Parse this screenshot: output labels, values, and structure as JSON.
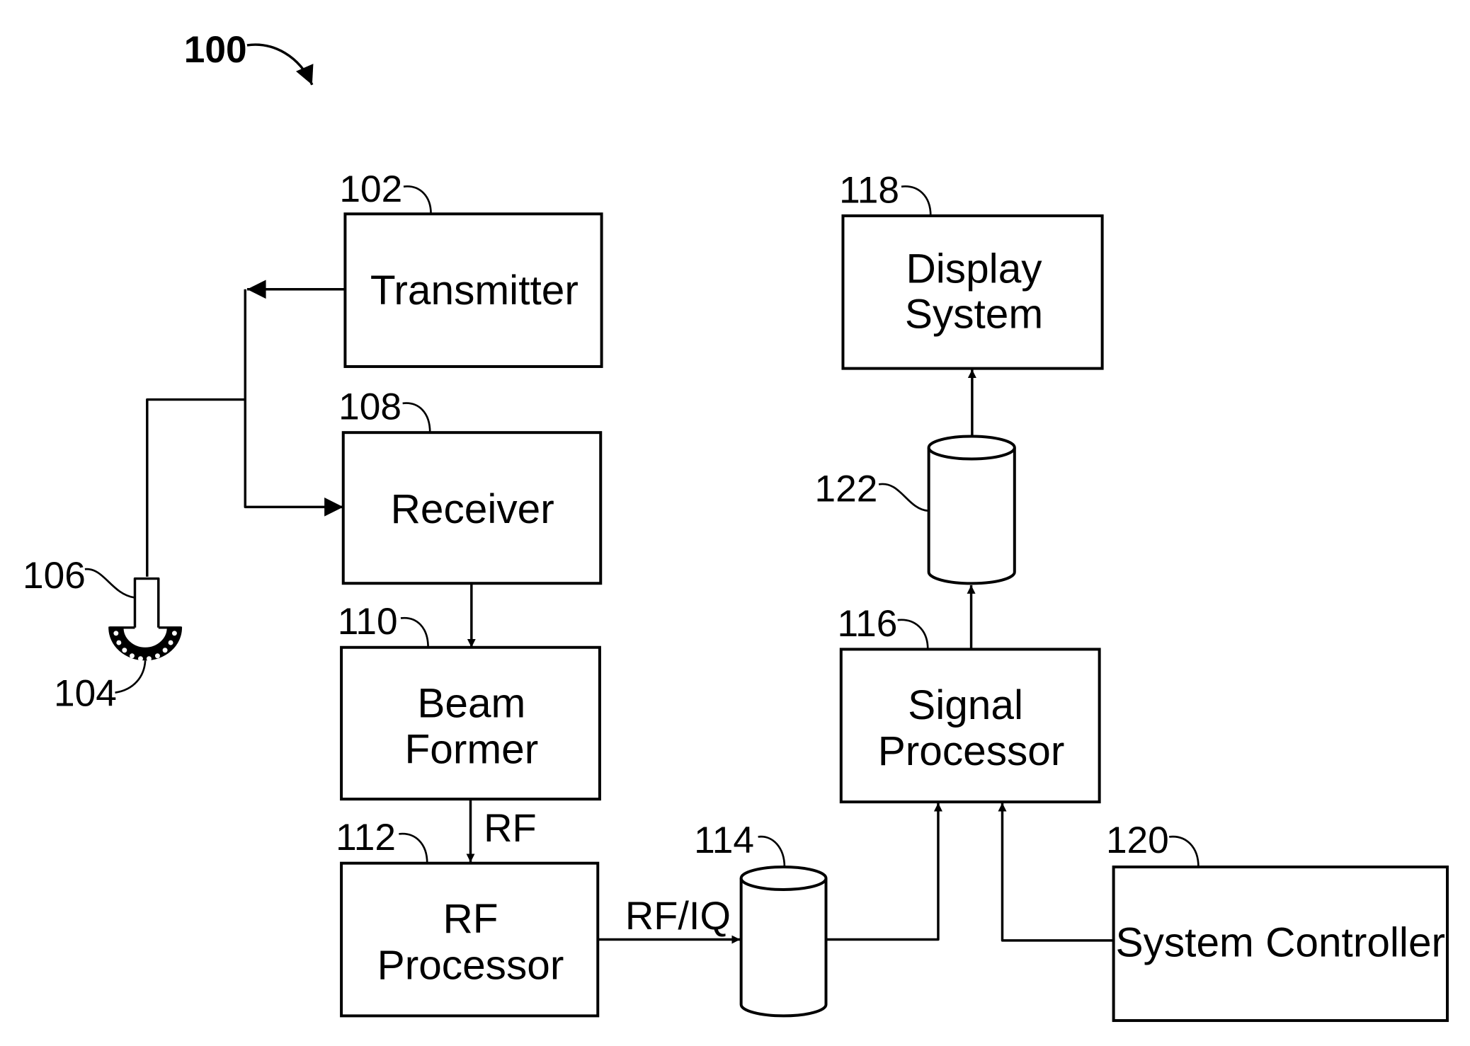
{
  "figure": {
    "ref": "100",
    "colors": {
      "ink": "#000000",
      "paper": "#ffffff"
    }
  },
  "blocks": {
    "transmitter": {
      "ref": "102",
      "lines": [
        "Transmitter"
      ]
    },
    "receiver": {
      "ref": "108",
      "lines": [
        "Receiver"
      ]
    },
    "beam_former": {
      "ref": "110",
      "lines": [
        "Beam",
        "Former"
      ]
    },
    "rf_processor": {
      "ref": "112",
      "lines": [
        "RF",
        "Processor"
      ]
    },
    "signal_processor": {
      "ref": "116",
      "lines": [
        "Signal",
        "Processor"
      ]
    },
    "display_system": {
      "ref": "118",
      "lines": [
        "Display",
        "System"
      ]
    },
    "system_controller": {
      "ref": "120",
      "lines": [
        "System Controller"
      ]
    }
  },
  "storage": {
    "buffer_114": {
      "ref": "114"
    },
    "buffer_122": {
      "ref": "122"
    }
  },
  "probe": {
    "transducer_ref": "104",
    "probe_ref": "106"
  },
  "signals": {
    "beamformer_to_rf": "RF",
    "rf_to_buffer": "RF/IQ"
  }
}
